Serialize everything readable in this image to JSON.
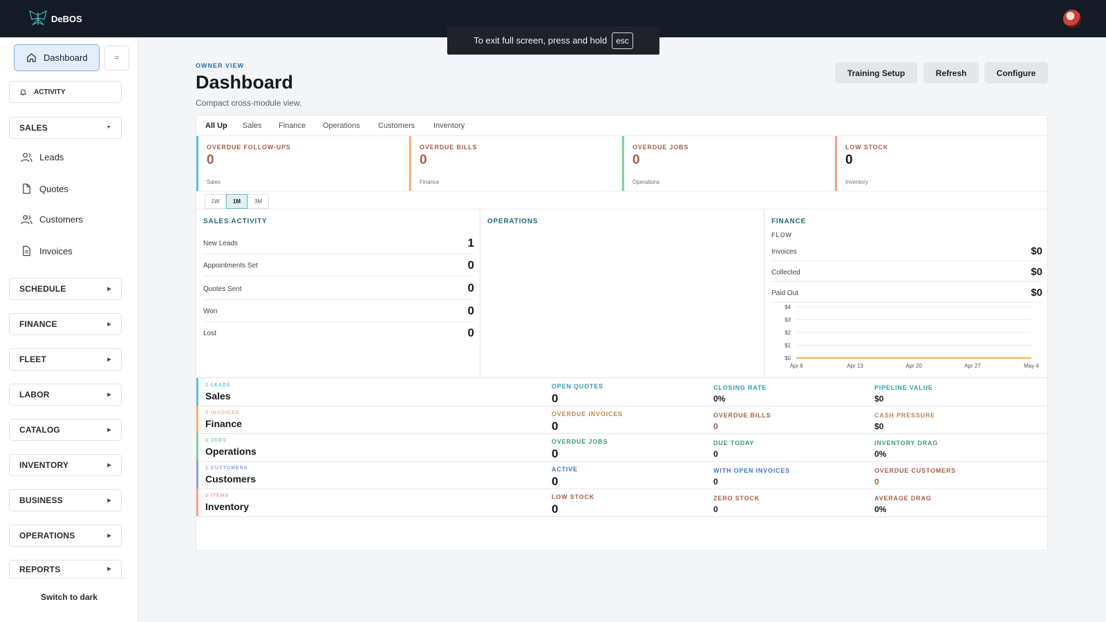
{
  "app": {
    "name": "DeBOS"
  },
  "fullscreen_notice": {
    "text": "To exit full screen, press and hold",
    "key": "esc"
  },
  "sidebar": {
    "dashboard_label": "Dashboard",
    "collapse_icon": "=",
    "activity_label": "ACTIVITY",
    "sales_label": "SALES",
    "sales_items": [
      {
        "label": "Leads",
        "icon": "users-icon"
      },
      {
        "label": "Quotes",
        "icon": "file-icon"
      },
      {
        "label": "Customers",
        "icon": "users-icon"
      },
      {
        "label": "Invoices",
        "icon": "document-icon"
      }
    ],
    "groups": [
      "SCHEDULE",
      "FINANCE",
      "FLEET",
      "LABOR",
      "CATALOG",
      "INVENTORY",
      "BUSINESS",
      "OPERATIONS",
      "REPORTS"
    ],
    "switch_theme": "Switch to dark"
  },
  "header": {
    "eyebrow": "OWNER VIEW",
    "title": "Dashboard",
    "subtitle": "Compact cross-module view.",
    "buttons": [
      "Training Setup",
      "Refresh",
      "Configure"
    ]
  },
  "tabs": [
    "All Up",
    "Sales",
    "Finance",
    "Operations",
    "Customers",
    "Inventory"
  ],
  "kpis": [
    {
      "label": "OVERDUE FOLLOW-UPS",
      "value": "0",
      "module": "Sales",
      "color": "#59c3d6"
    },
    {
      "label": "OVERDUE BILLS",
      "value": "0",
      "module": "Finance",
      "color": "#f0b27a"
    },
    {
      "label": "OVERDUE JOBS",
      "value": "0",
      "module": "Operations",
      "color": "#7dd3a3"
    },
    {
      "label": "LOW STOCK",
      "value": "0",
      "module": "Inventory",
      "color": "#f0a493"
    }
  ],
  "ranges": [
    "1W",
    "1M",
    "3M"
  ],
  "active_range": "1M",
  "sales_activity": {
    "title": "SALES ACTIVITY",
    "rows": [
      {
        "label": "New Leads",
        "value": "1"
      },
      {
        "label": "Appointments Set",
        "value": "0"
      },
      {
        "label": "Quotes Sent",
        "value": "0"
      },
      {
        "label": "Won",
        "value": "0"
      },
      {
        "label": "Lost",
        "value": "0"
      }
    ]
  },
  "operations": {
    "title": "OPERATIONS"
  },
  "finance": {
    "title": "FINANCE",
    "flow_label": "FLOW",
    "rows": [
      {
        "label": "Invoices",
        "value": "$0"
      },
      {
        "label": "Collected",
        "value": "$0"
      },
      {
        "label": "Paid Out",
        "value": "$0"
      }
    ]
  },
  "chart_data": {
    "type": "line",
    "x": [
      "Apr 6",
      "Apr 13",
      "Apr 20",
      "Apr 27",
      "May 4"
    ],
    "y_ticks": [
      "$0",
      "$1",
      "$2",
      "$3",
      "$4"
    ],
    "ylim": [
      0,
      4
    ],
    "series": [
      {
        "values": [
          0,
          0,
          0,
          0,
          0
        ],
        "color": "#f5b860"
      }
    ],
    "grid": true
  },
  "summary": [
    {
      "small": "1 LEADS",
      "name": "Sales",
      "color": "#59c3d6",
      "metrics": [
        {
          "label": "OPEN QUOTES",
          "value": "0",
          "lc": "#2f9bb0",
          "vc": "#15181c"
        },
        {
          "label": "CLOSING RATE",
          "value": "0%",
          "lc": "#2f9bb0",
          "vc": "#15181c"
        },
        {
          "label": "PIPELINE VALUE",
          "value": "$0",
          "lc": "#2f9bb0",
          "vc": "#15181c"
        }
      ]
    },
    {
      "small": "0 INVOICES",
      "name": "Finance",
      "color": "#f0b27a",
      "metrics": [
        {
          "label": "OVERDUE INVOICES",
          "value": "0",
          "lc": "#b9874e",
          "vc": "#15181c"
        },
        {
          "label": "OVERDUE BILLS",
          "value": "0",
          "lc": "#a35f4a",
          "vc": "#a35f4a"
        },
        {
          "label": "CASH PRESSURE",
          "value": "$0",
          "lc": "#b9874e",
          "vc": "#15181c"
        }
      ]
    },
    {
      "small": "0 JOBS",
      "name": "Operations",
      "color": "#7dd3a3",
      "metrics": [
        {
          "label": "OVERDUE JOBS",
          "value": "0",
          "lc": "#3f9a6c",
          "vc": "#15181c"
        },
        {
          "label": "DUE TODAY",
          "value": "0",
          "lc": "#3f9a6c",
          "vc": "#15181c"
        },
        {
          "label": "INVENTORY DRAG",
          "value": "0%",
          "lc": "#3f9a6c",
          "vc": "#15181c"
        }
      ]
    },
    {
      "small": "1 CUSTOMERS",
      "name": "Customers",
      "color": "#8da3e0",
      "metrics": [
        {
          "label": "ACTIVE",
          "value": "0",
          "lc": "#3f78c2",
          "vc": "#15181c"
        },
        {
          "label": "WITH OPEN INVOICES",
          "value": "0",
          "lc": "#3f78c2",
          "vc": "#15181c"
        },
        {
          "label": "OVERDUE CUSTOMERS",
          "value": "0",
          "lc": "#a35f4a",
          "vc": "#a35f4a"
        }
      ]
    },
    {
      "small": "0 ITEMS",
      "name": "Inventory",
      "color": "#f0a493",
      "metrics": [
        {
          "label": "LOW STOCK",
          "value": "0",
          "lc": "#a35f4a",
          "vc": "#15181c"
        },
        {
          "label": "ZERO STOCK",
          "value": "0",
          "lc": "#a35f4a",
          "vc": "#15181c"
        },
        {
          "label": "AVERAGE DRAG",
          "value": "0%",
          "lc": "#a35f4a",
          "vc": "#15181c"
        }
      ]
    }
  ]
}
